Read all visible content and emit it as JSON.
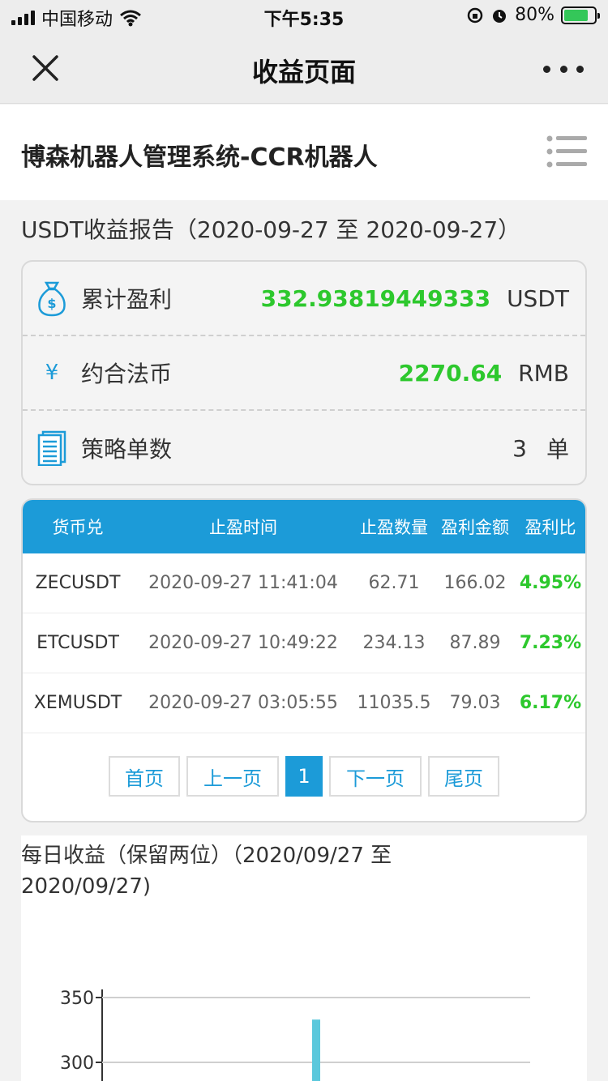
{
  "status_bar": {
    "carrier": "中国移动",
    "time": "下午5:35",
    "battery_percent": "80%"
  },
  "nav": {
    "title": "收益页面",
    "close_icon": "close-icon",
    "more_icon": "more-icon"
  },
  "header": {
    "system_title": "博森机器人管理系统-CCR机器人",
    "menu_icon": "list-menu-icon"
  },
  "report": {
    "title": "USDT收益报告（2020-09-27 至 2020-09-27）"
  },
  "summary": {
    "total_profit_label": "累计盈利",
    "total_profit_value": "332.93819449333",
    "total_profit_unit": "USDT",
    "fiat_label": "约合法币",
    "fiat_symbol": "¥",
    "fiat_value": "2270.64",
    "fiat_unit": "RMB",
    "orders_label": "策略单数",
    "orders_value": "3",
    "orders_unit": "单",
    "accent_color": "#2dc82d"
  },
  "table": {
    "headers": [
      "货币兑",
      "止盈时间",
      "止盈数量",
      "盈利金额",
      "盈利比"
    ],
    "rows": [
      [
        "ZECUSDT",
        "2020-09-27 11:41:04",
        "62.71",
        "166.02",
        "4.95%"
      ],
      [
        "ETCUSDT",
        "2020-09-27 10:49:22",
        "234.13",
        "87.89",
        "7.23%"
      ],
      [
        "XEMUSDT",
        "2020-09-27 03:05:55",
        "11035.5",
        "79.03",
        "6.17%"
      ]
    ],
    "header_color": "#1c9bd8"
  },
  "pagination": {
    "first": "首页",
    "prev": "上一页",
    "current": "1",
    "next": "下一页",
    "last": "尾页"
  },
  "chart_data": {
    "type": "bar",
    "title": "每日收益（保留两位）（2020/09/27 至 2020/09/27)",
    "y_ticks": [
      350,
      300
    ],
    "values": [
      333
    ],
    "bar_color": "#5bc8dc",
    "grid": true
  }
}
